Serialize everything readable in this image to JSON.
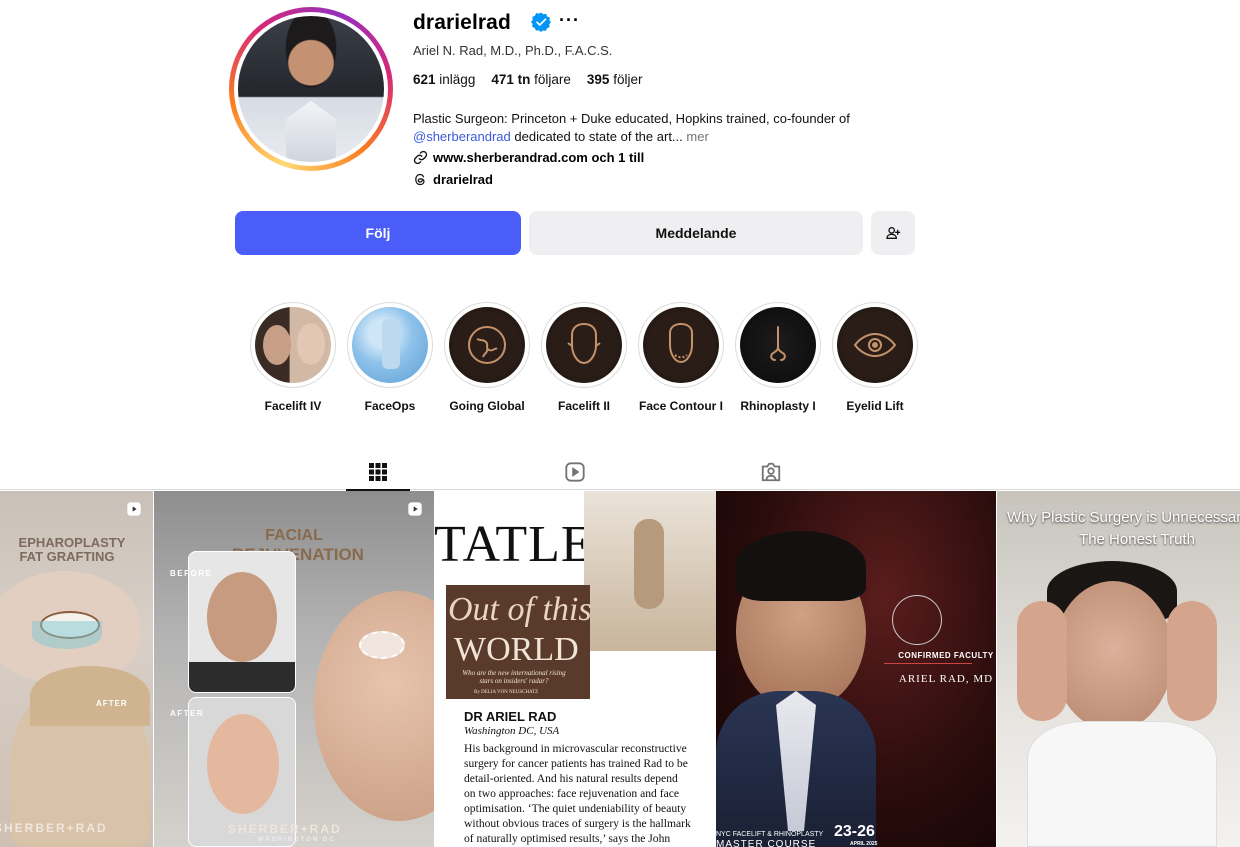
{
  "profile": {
    "username": "drarielrad",
    "full_name": "Ariel N. Rad, M.D., Ph.D., F.A.C.S.",
    "more_icon": "more-horizontal-icon",
    "stats": {
      "posts_count": "621",
      "posts_label": "inlägg",
      "followers_count": "471 tn",
      "followers_label": "följare",
      "following_count": "395",
      "following_label": "följer"
    },
    "bio": {
      "line1": "Plastic Surgeon: Princeton + Duke educated, Hopkins trained, co-founder of",
      "mention": "@sherberandrad",
      "line2": " dedicated to state of the art...",
      "more": "mer"
    },
    "link": "www.sherberandrad.com och 1 till",
    "threads": "drarielrad"
  },
  "actions": {
    "follow": "Följ",
    "message": "Meddelande"
  },
  "colors": {
    "follow_bg": "#4a5df9",
    "verified": "#0095f6",
    "mention": "#3b5bdb"
  },
  "highlights": [
    {
      "label": "Facelift IV"
    },
    {
      "label": "FaceOps"
    },
    {
      "label": "Going Global"
    },
    {
      "label": "Facelift II"
    },
    {
      "label": "Face Contour I"
    },
    {
      "label": "Rhinoplasty I"
    },
    {
      "label": "Eyelid Lift"
    }
  ],
  "posts": {
    "p1": {
      "line1": "EPHAROPLASTY",
      "line2": "FAT GRAFTING",
      "after": "AFTER",
      "brand": "SHERBER+RAD"
    },
    "p2": {
      "title1": "FACIAL",
      "title2": "REJUVENATION",
      "before": "BEFORE",
      "after": "AFTER",
      "brand": "SHERBER+RAD",
      "brand_sub": "WASHINGTON DC"
    },
    "p3": {
      "mag": "TATLER",
      "headline1": "Out of this",
      "headline2": "WORLD",
      "sub": "Who are the new international rising stars on insiders' radar?",
      "byline": "By DELIA VON NEUSCHATZ",
      "name": "DR ARIEL RAD",
      "location": "Washington DC, USA",
      "body": "His background in microvascular reconstructive surgery for cancer patients has trained Rad to be detail-oriented. And his natural results depend on two approaches: face rejuvenation and face optimisation. ‘The quiet undeniability of beauty without obvious traces of surgery is the hallmark of naturally optimised results,’ says the John"
    },
    "p4": {
      "faculty": "CONFIRMED FACULTY",
      "name": "ARIEL RAD, MD",
      "course_line": "NYC FACELIFT & RHINOPLASTY",
      "course": "MASTER COURSE",
      "dates": "23-26",
      "month": "APRIL 2025"
    },
    "p5": {
      "title1": "Why Plastic Surgery is Unnecessar",
      "title2": "The Honest Truth"
    }
  }
}
